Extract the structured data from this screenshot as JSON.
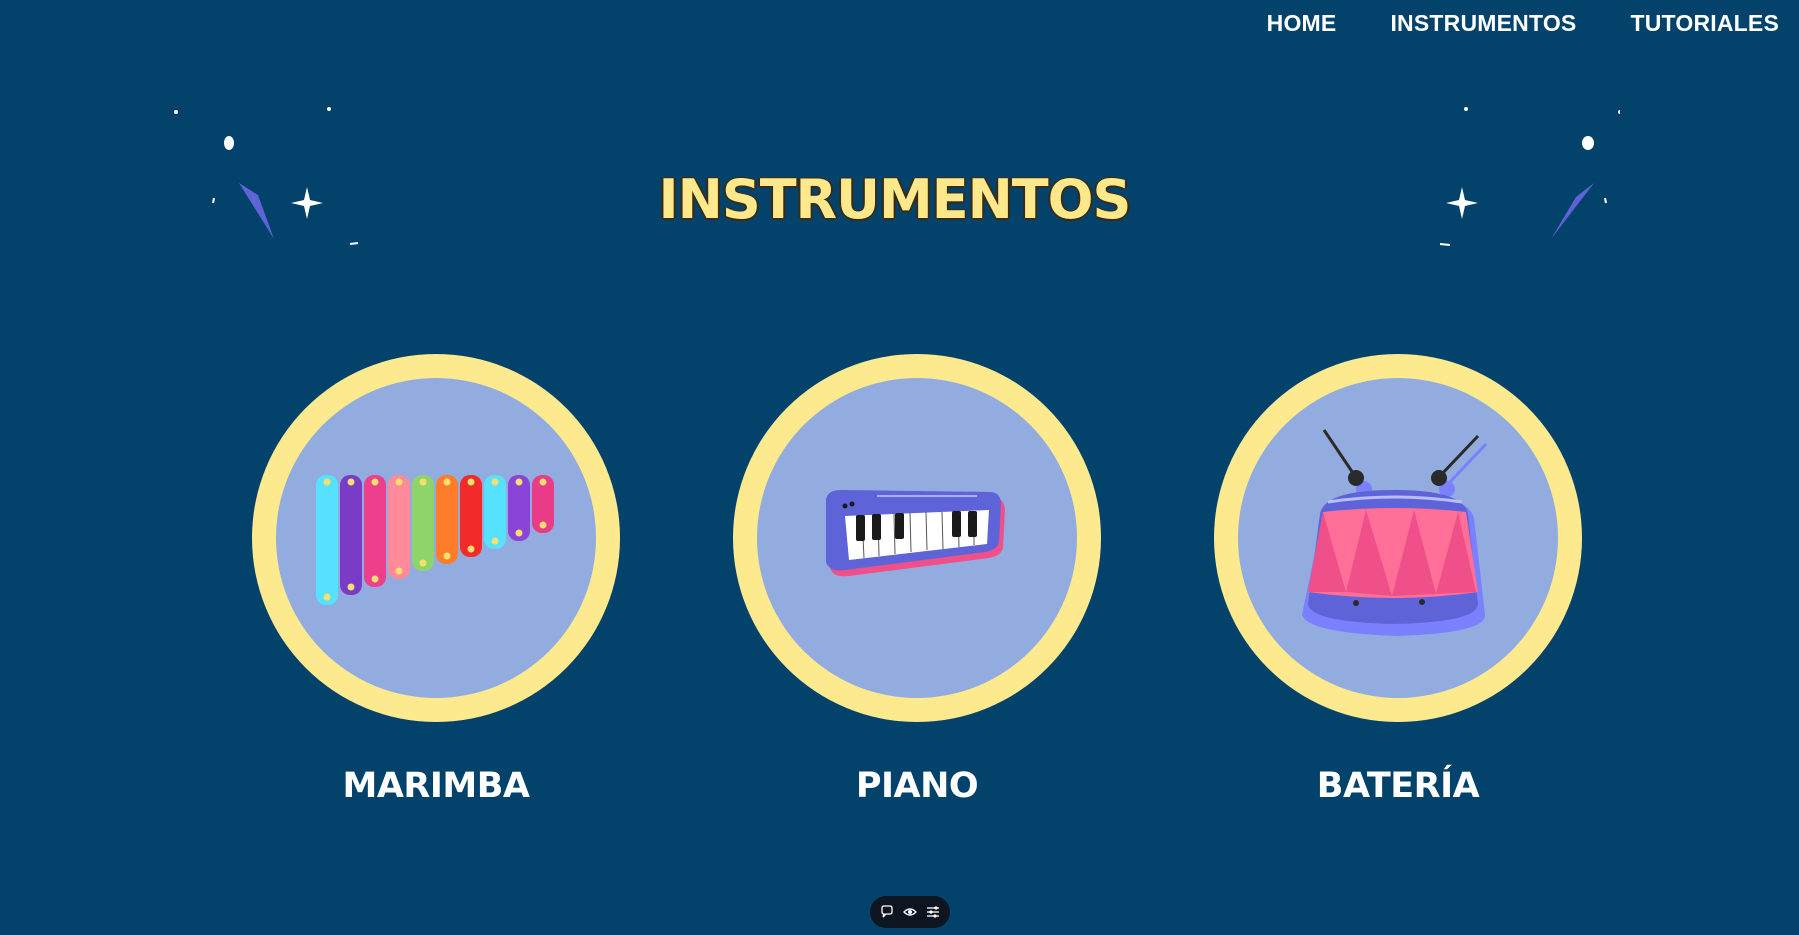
{
  "nav": {
    "items": [
      {
        "label": "HOME"
      },
      {
        "label": "INSTRUMENTOS"
      },
      {
        "label": "TUTORIALES"
      }
    ]
  },
  "page": {
    "title": "INSTRUMENTOS"
  },
  "instruments": [
    {
      "label": "MARIMBA",
      "icon": "marimba-icon"
    },
    {
      "label": "PIANO",
      "icon": "piano-icon"
    },
    {
      "label": "BATERÍA",
      "icon": "drum-icon"
    }
  ],
  "toolbar": {
    "icons": [
      "comment-icon",
      "eye-icon",
      "settings-icon"
    ]
  },
  "colors": {
    "background": "#03426a",
    "title": "#fde98c",
    "ring": "#fdea8f",
    "circle": "#93acdf"
  }
}
